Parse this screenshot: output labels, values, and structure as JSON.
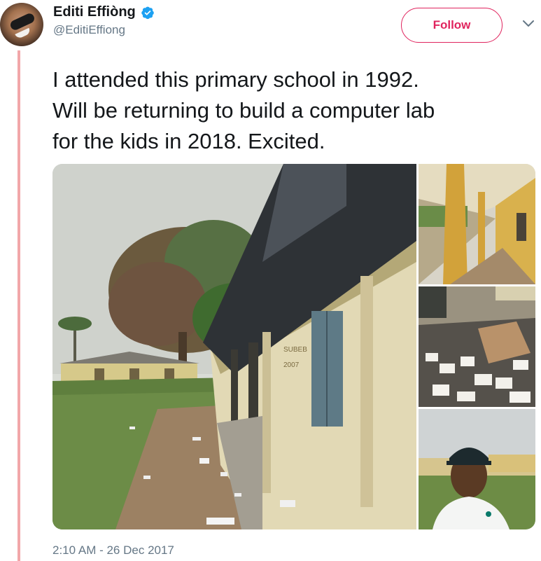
{
  "tweet": {
    "author": {
      "display_name": "Editi Effiòng",
      "handle": "@EditiEffiong",
      "verified": true,
      "avatar_icon": "avatar-photo"
    },
    "follow_label": "Follow",
    "menu_icon": "chevron-down-icon",
    "text_lines": [
      "I attended this primary school in 1992.",
      "Will be returning to build a computer lab",
      "for the kids in 2018. Excited."
    ],
    "timestamp": "2:10 AM - 26 Dec 2017",
    "media": {
      "photos": [
        {
          "name": "school-building-photo",
          "description": "school block with damaged roof"
        },
        {
          "name": "corridor-photo",
          "description": "school corridor"
        },
        {
          "name": "classroom-papers-photo",
          "description": "classroom floor with papers"
        },
        {
          "name": "selfie-photo",
          "description": "man in cap selfie"
        }
      ],
      "sign_text": [
        "SUBEB",
        "2007"
      ]
    }
  },
  "colors": {
    "follow_accent": "#e0245e",
    "verified_blue": "#1da1f2",
    "thread_line": "#f2a7a9",
    "secondary_text": "#657786"
  }
}
